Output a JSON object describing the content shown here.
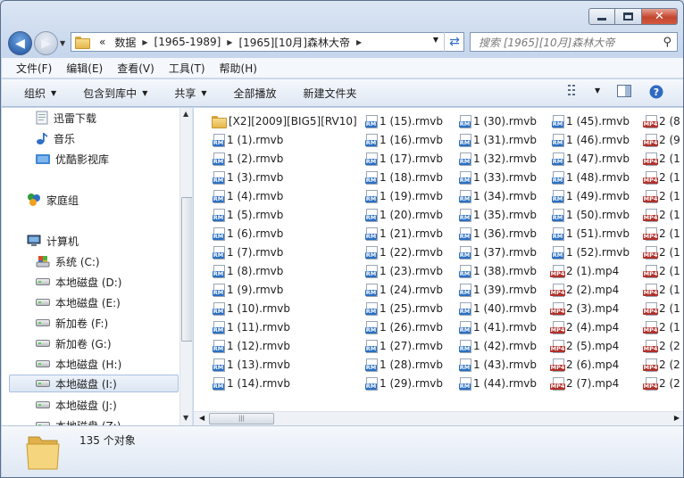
{
  "window": {
    "caption": {
      "minimize": "—",
      "maximize": "□",
      "close": "✕"
    }
  },
  "address": {
    "overflow": "«",
    "crumbs": [
      "数据",
      "[1965-1989]",
      "[1965][10月]森林大帝"
    ]
  },
  "search": {
    "placeholder": "搜索 [1965][10月]森林大帝"
  },
  "menu": [
    "文件(F)",
    "编辑(E)",
    "查看(V)",
    "工具(T)",
    "帮助(H)"
  ],
  "toolbar": {
    "organize": "组织",
    "include_in_library": "包含到库中",
    "share": "共享",
    "play_all": "全部播放",
    "new_folder": "新建文件夹"
  },
  "navpane": {
    "items": [
      {
        "label": "迅雷下载",
        "icon": "thunder-download-icon"
      },
      {
        "label": "音乐",
        "icon": "music-icon"
      },
      {
        "label": "优酷影视库",
        "icon": "youku-library-icon"
      },
      {
        "label": "家庭组",
        "icon": "homegroup-icon"
      },
      {
        "label": "计算机",
        "icon": "computer-icon"
      },
      {
        "label": "系统 (C:)",
        "icon": "system-drive-icon"
      },
      {
        "label": "本地磁盘 (D:)",
        "icon": "drive-icon"
      },
      {
        "label": "本地磁盘 (E:)",
        "icon": "drive-icon"
      },
      {
        "label": "新加卷 (F:)",
        "icon": "drive-icon"
      },
      {
        "label": "新加卷 (G:)",
        "icon": "drive-icon"
      },
      {
        "label": "本地磁盘 (H:)",
        "icon": "drive-icon"
      },
      {
        "label": "本地磁盘 (I:)",
        "icon": "drive-icon",
        "selected": true
      },
      {
        "label": "本地磁盘 (J:)",
        "icon": "drive-icon"
      },
      {
        "label": "本地磁盘 (Z:)",
        "icon": "drive-icon"
      }
    ]
  },
  "files": {
    "col1": [
      "[X2][2009][BIG5][RV10]",
      "1 (1).rmvb",
      "1 (2).rmvb",
      "1 (3).rmvb",
      "1 (4).rmvb",
      "1 (5).rmvb",
      "1 (6).rmvb",
      "1 (7).rmvb",
      "1 (8).rmvb",
      "1 (9).rmvb",
      "1 (10).rmvb",
      "1 (11).rmvb",
      "1 (12).rmvb",
      "1 (13).rmvb",
      "1 (14).rmvb"
    ],
    "col2": [
      "1 (15).rmvb",
      "1 (16).rmvb",
      "1 (17).rmvb",
      "1 (18).rmvb",
      "1 (19).rmvb",
      "1 (20).rmvb",
      "1 (21).rmvb",
      "1 (22).rmvb",
      "1 (23).rmvb",
      "1 (24).rmvb",
      "1 (25).rmvb",
      "1 (26).rmvb",
      "1 (27).rmvb",
      "1 (28).rmvb",
      "1 (29).rmvb"
    ],
    "col3": [
      "1 (30).rmvb",
      "1 (31).rmvb",
      "1 (32).rmvb",
      "1 (33).rmvb",
      "1 (34).rmvb",
      "1 (35).rmvb",
      "1 (36).rmvb",
      "1 (37).rmvb",
      "1 (38).rmvb",
      "1 (39).rmvb",
      "1 (40).rmvb",
      "1 (41).rmvb",
      "1 (42).rmvb",
      "1 (43).rmvb",
      "1 (44).rmvb"
    ],
    "col4": [
      "1 (45).rmvb",
      "1 (46).rmvb",
      "1 (47).rmvb",
      "1 (48).rmvb",
      "1 (49).rmvb",
      "1 (50).rmvb",
      "1 (51).rmvb",
      "1 (52).rmvb",
      "2 (1).mp4",
      "2 (2).mp4",
      "2 (3).mp4",
      "2 (4).mp4",
      "2 (5).mp4",
      "2 (6).mp4",
      "2 (7).mp4"
    ],
    "col5": [
      "2 (8",
      "2 (9",
      "2 (1",
      "2 (1",
      "2 (1",
      "2 (1",
      "2 (1",
      "2 (1",
      "2 (1",
      "2 (1",
      "2 (1",
      "2 (1",
      "2 (2",
      "2 (2",
      "2 (2"
    ]
  },
  "status": {
    "count": "135 个对象"
  }
}
